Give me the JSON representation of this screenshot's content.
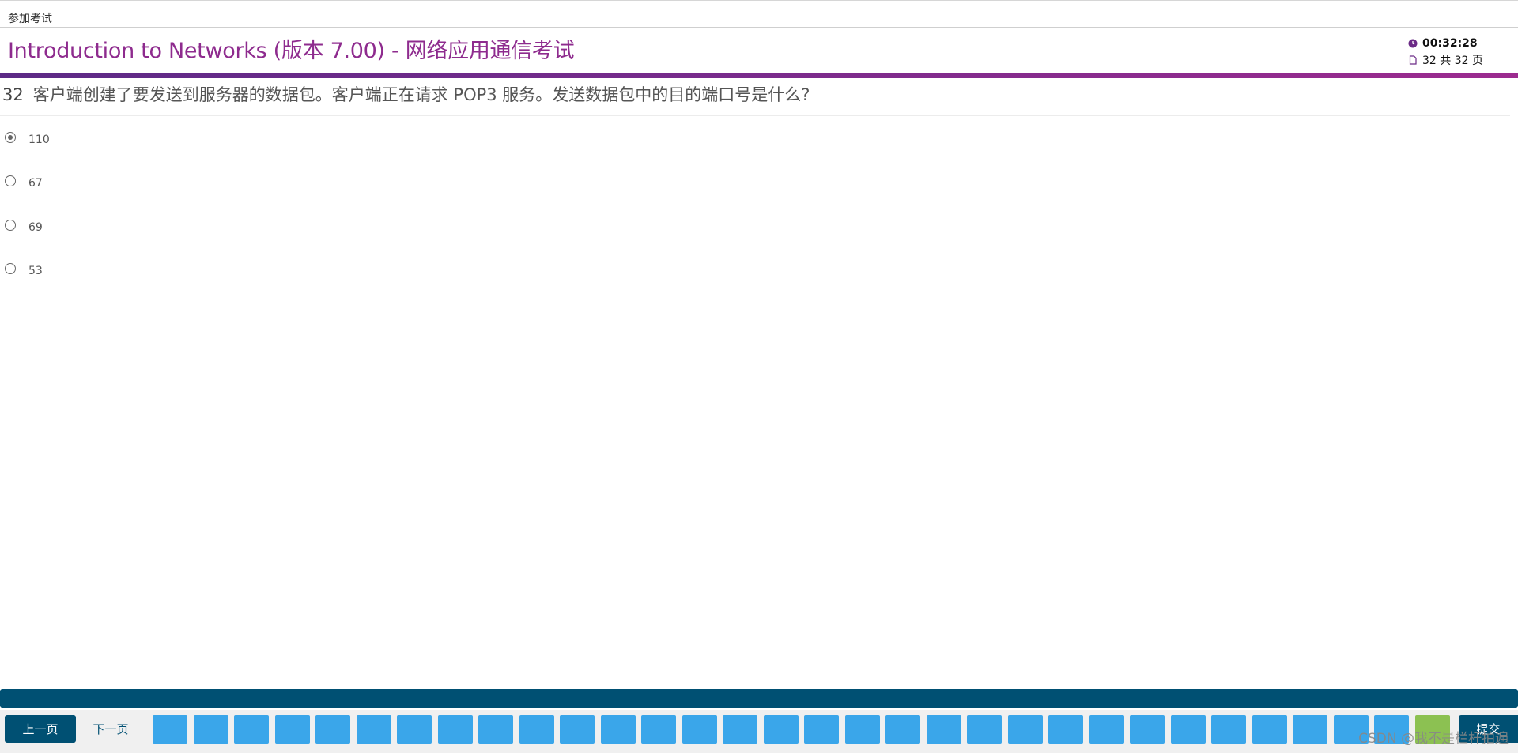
{
  "breadcrumb": "参加考试",
  "exam_title": "Introduction to Networks (版本 7.00) - 网络应用通信考试",
  "timer": "00:32:28",
  "page_indicator": "32 共 32 页",
  "question": {
    "number": "32",
    "text": "客户端创建了要发送到服务器的数据包。客户端正在请求 POP3 服务。发送数据包中的目的端口号是什么?"
  },
  "options": [
    {
      "label": "110",
      "selected": true
    },
    {
      "label": "67",
      "selected": false
    },
    {
      "label": "69",
      "selected": false
    },
    {
      "label": "53",
      "selected": false
    }
  ],
  "nav": {
    "prev_label": "上一页",
    "next_label": "下一页",
    "submit_label": "提交",
    "total_pages": 32,
    "current_page": 32
  },
  "watermark": "CSDN @我不是栏杆拍遍",
  "colors": {
    "title": "#8e2b8e",
    "nav_dark": "#005073",
    "page_box": "#3aa6ea",
    "page_current": "#8cc152"
  },
  "icons": {
    "timer": "clock-icon",
    "pages": "document-icon"
  }
}
